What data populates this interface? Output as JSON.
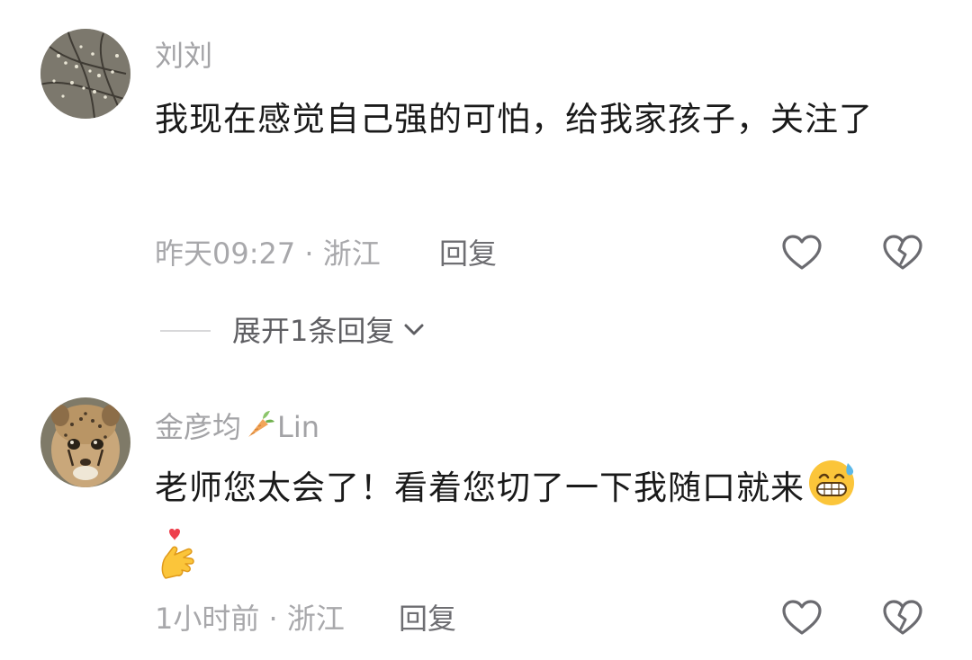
{
  "comments": [
    {
      "username": "刘刘",
      "text": "我现在感觉自己强的可怕，给我家孩子，关注了",
      "time": "昨天09:27",
      "location": "浙江",
      "separator": " · ",
      "reply_label": "回复",
      "avatar_icon": "branches-photo-avatar"
    },
    {
      "username_name": "金彦均",
      "username_suffix": "Lin",
      "username_icon": "carrot-icon",
      "text": "老师您太会了！看着您切了一下我随口就来",
      "emoji_1": "grinning-sweat-emoji",
      "emoji_2": "finger-heart-emoji",
      "time": "1小时前",
      "location": "浙江",
      "separator": " · ",
      "reply_label": "回复",
      "avatar_icon": "cheetah-cub-photo-avatar"
    }
  ],
  "expand_replies_label": "展开1条回复",
  "icons": {
    "like": "heart-outline-icon",
    "dislike": "broken-heart-icon",
    "expand": "chevron-down-icon"
  },
  "colors": {
    "username": "#a3a3a6",
    "body": "#1a1a1a",
    "meta": "#a8a8ab",
    "reply": "#6e6e72",
    "icon": "#6b6b70"
  }
}
